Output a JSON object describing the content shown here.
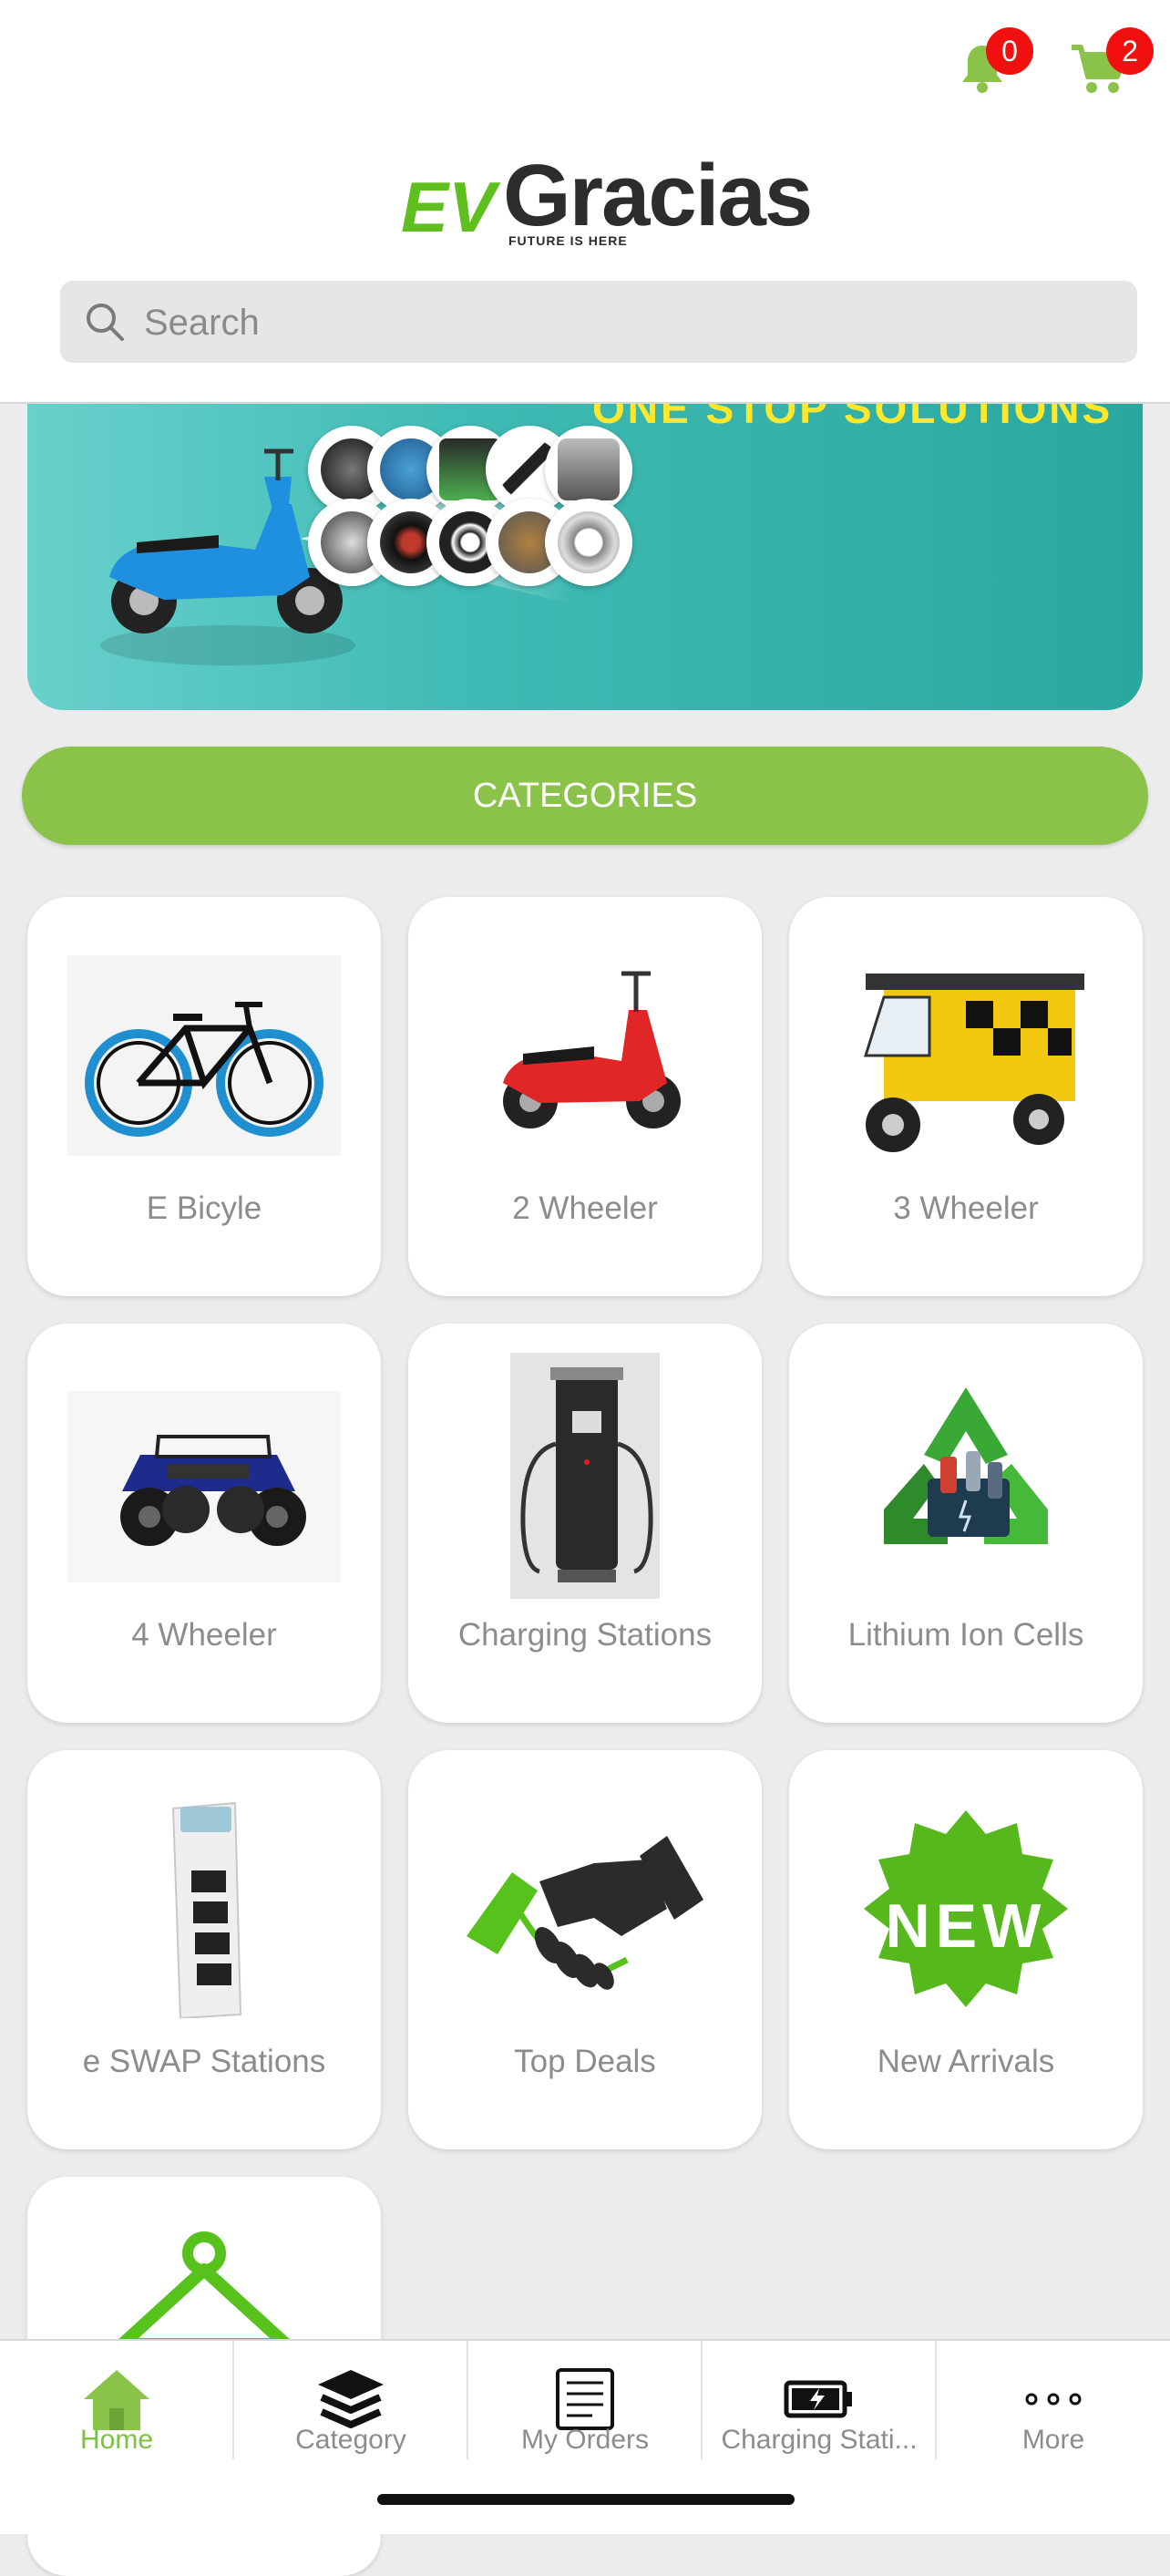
{
  "header": {
    "notifications_count": "0",
    "cart_count": "2",
    "logo": {
      "ev": "EV",
      "brand": "Gracias",
      "tagline": "FUTURE IS HERE"
    }
  },
  "search": {
    "placeholder": "Search",
    "value": ""
  },
  "banner": {
    "headline": "ONE STOP SOLUTIONS"
  },
  "categories_button": "CATEGORIES",
  "categories": [
    {
      "label": "E Bicyle"
    },
    {
      "label": "2 Wheeler"
    },
    {
      "label": "3 Wheeler"
    },
    {
      "label": "4 Wheeler"
    },
    {
      "label": "Charging Stations"
    },
    {
      "label": "Lithium Ion Cells"
    },
    {
      "label": "e SWAP Stations"
    },
    {
      "label": "Top Deals"
    },
    {
      "label": "New Arrivals"
    },
    {
      "label": ""
    }
  ],
  "badges": {
    "new_text": "NEW"
  },
  "tabbar": [
    {
      "label": "Home",
      "icon": "home-icon",
      "active": true
    },
    {
      "label": "Category",
      "icon": "layers-icon"
    },
    {
      "label": "My Orders",
      "icon": "orders-icon"
    },
    {
      "label": "Charging Stati...",
      "icon": "battery-icon"
    },
    {
      "label": "More",
      "icon": "more-icon"
    }
  ],
  "colors": {
    "accent": "#8bc34a",
    "badge": "#f01010",
    "brand_green": "#5fbf1e"
  }
}
